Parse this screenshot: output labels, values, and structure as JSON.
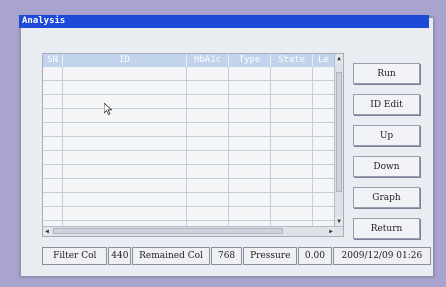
{
  "window": {
    "title": "Analysis"
  },
  "table": {
    "columns": [
      "SN",
      "ID",
      "HbA1c",
      "Type",
      "State",
      "Le"
    ],
    "row_count": 12
  },
  "buttons": {
    "run": "Run",
    "id_edit": "ID Edit",
    "up": "Up",
    "down": "Down",
    "graph": "Graph",
    "return": "Return"
  },
  "status": {
    "filter_label": "Filter Col",
    "filter_value": "440",
    "remained_label": "Remained Col",
    "remained_value": "768",
    "pressure_label": "Pressure",
    "pressure_value": "0.00",
    "datetime": "2009/12/09   01:26"
  },
  "colors": {
    "title_bar": "#1d4bd8",
    "header": "#c2d4ec",
    "frame": "#a9a3cf"
  }
}
